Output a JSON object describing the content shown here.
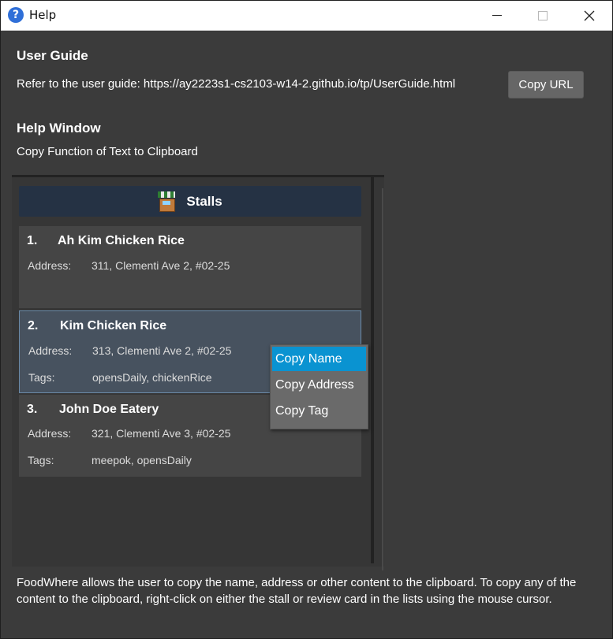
{
  "window": {
    "title": "Help"
  },
  "user_guide": {
    "heading": "User Guide",
    "text": "Refer to the user guide: https://ay2223s1-cs2103-w14-2.github.io/tp/UserGuide.html",
    "copy_button": "Copy URL"
  },
  "help_window": {
    "heading": "Help Window",
    "subtitle": "Copy Function of Text to Clipboard"
  },
  "stalls_panel": {
    "title": "Stalls",
    "cards": [
      {
        "index": "1.",
        "name": "Ah Kim Chicken Rice",
        "address_label": "Address:",
        "address": "311, Clementi Ave 2, #02-25"
      },
      {
        "index": "2.",
        "name": "Kim Chicken Rice",
        "address_label": "Address:",
        "address": "313, Clementi Ave 2, #02-25",
        "tags_label": "Tags:",
        "tags": "opensDaily, chickenRice"
      },
      {
        "index": "3.",
        "name": "John Doe Eatery",
        "address_label": "Address:",
        "address": "321, Clementi Ave 3, #02-25",
        "tags_label": "Tags:",
        "tags": "meepok, opensDaily"
      }
    ]
  },
  "context_menu": {
    "items": [
      "Copy Name",
      "Copy Address",
      "Copy Tag"
    ],
    "active_item": "Copy Name"
  },
  "footer": {
    "text": "FoodWhere allows the user to copy the name, address or other content to the clipboard. To copy any of the content to the clipboard, right-click on either the stall or review card in the lists using the mouse cursor."
  },
  "colors": {
    "background": "#3b3b3b",
    "header_bar": "#253244",
    "selection": "#0a93d1"
  }
}
